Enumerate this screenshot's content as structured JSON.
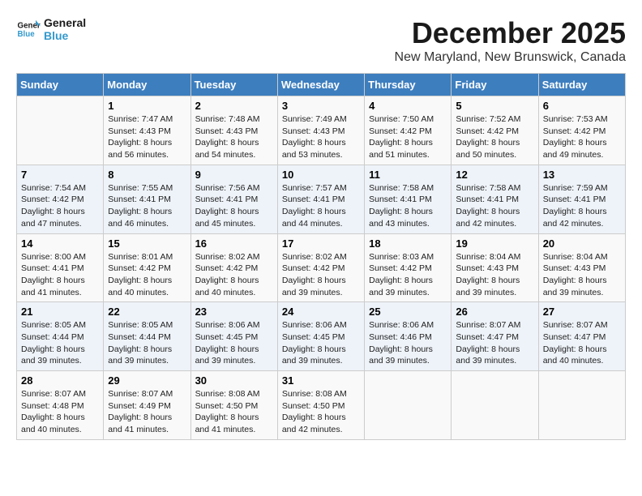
{
  "header": {
    "logo_line1": "General",
    "logo_line2": "Blue",
    "title": "December 2025",
    "subtitle": "New Maryland, New Brunswick, Canada"
  },
  "days_of_week": [
    "Sunday",
    "Monday",
    "Tuesday",
    "Wednesday",
    "Thursday",
    "Friday",
    "Saturday"
  ],
  "weeks": [
    [
      {
        "day": "",
        "info": ""
      },
      {
        "day": "1",
        "info": "Sunrise: 7:47 AM\nSunset: 4:43 PM\nDaylight: 8 hours\nand 56 minutes."
      },
      {
        "day": "2",
        "info": "Sunrise: 7:48 AM\nSunset: 4:43 PM\nDaylight: 8 hours\nand 54 minutes."
      },
      {
        "day": "3",
        "info": "Sunrise: 7:49 AM\nSunset: 4:43 PM\nDaylight: 8 hours\nand 53 minutes."
      },
      {
        "day": "4",
        "info": "Sunrise: 7:50 AM\nSunset: 4:42 PM\nDaylight: 8 hours\nand 51 minutes."
      },
      {
        "day": "5",
        "info": "Sunrise: 7:52 AM\nSunset: 4:42 PM\nDaylight: 8 hours\nand 50 minutes."
      },
      {
        "day": "6",
        "info": "Sunrise: 7:53 AM\nSunset: 4:42 PM\nDaylight: 8 hours\nand 49 minutes."
      }
    ],
    [
      {
        "day": "7",
        "info": "Sunrise: 7:54 AM\nSunset: 4:42 PM\nDaylight: 8 hours\nand 47 minutes."
      },
      {
        "day": "8",
        "info": "Sunrise: 7:55 AM\nSunset: 4:41 PM\nDaylight: 8 hours\nand 46 minutes."
      },
      {
        "day": "9",
        "info": "Sunrise: 7:56 AM\nSunset: 4:41 PM\nDaylight: 8 hours\nand 45 minutes."
      },
      {
        "day": "10",
        "info": "Sunrise: 7:57 AM\nSunset: 4:41 PM\nDaylight: 8 hours\nand 44 minutes."
      },
      {
        "day": "11",
        "info": "Sunrise: 7:58 AM\nSunset: 4:41 PM\nDaylight: 8 hours\nand 43 minutes."
      },
      {
        "day": "12",
        "info": "Sunrise: 7:58 AM\nSunset: 4:41 PM\nDaylight: 8 hours\nand 42 minutes."
      },
      {
        "day": "13",
        "info": "Sunrise: 7:59 AM\nSunset: 4:41 PM\nDaylight: 8 hours\nand 42 minutes."
      }
    ],
    [
      {
        "day": "14",
        "info": "Sunrise: 8:00 AM\nSunset: 4:41 PM\nDaylight: 8 hours\nand 41 minutes."
      },
      {
        "day": "15",
        "info": "Sunrise: 8:01 AM\nSunset: 4:42 PM\nDaylight: 8 hours\nand 40 minutes."
      },
      {
        "day": "16",
        "info": "Sunrise: 8:02 AM\nSunset: 4:42 PM\nDaylight: 8 hours\nand 40 minutes."
      },
      {
        "day": "17",
        "info": "Sunrise: 8:02 AM\nSunset: 4:42 PM\nDaylight: 8 hours\nand 39 minutes."
      },
      {
        "day": "18",
        "info": "Sunrise: 8:03 AM\nSunset: 4:42 PM\nDaylight: 8 hours\nand 39 minutes."
      },
      {
        "day": "19",
        "info": "Sunrise: 8:04 AM\nSunset: 4:43 PM\nDaylight: 8 hours\nand 39 minutes."
      },
      {
        "day": "20",
        "info": "Sunrise: 8:04 AM\nSunset: 4:43 PM\nDaylight: 8 hours\nand 39 minutes."
      }
    ],
    [
      {
        "day": "21",
        "info": "Sunrise: 8:05 AM\nSunset: 4:44 PM\nDaylight: 8 hours\nand 39 minutes."
      },
      {
        "day": "22",
        "info": "Sunrise: 8:05 AM\nSunset: 4:44 PM\nDaylight: 8 hours\nand 39 minutes."
      },
      {
        "day": "23",
        "info": "Sunrise: 8:06 AM\nSunset: 4:45 PM\nDaylight: 8 hours\nand 39 minutes."
      },
      {
        "day": "24",
        "info": "Sunrise: 8:06 AM\nSunset: 4:45 PM\nDaylight: 8 hours\nand 39 minutes."
      },
      {
        "day": "25",
        "info": "Sunrise: 8:06 AM\nSunset: 4:46 PM\nDaylight: 8 hours\nand 39 minutes."
      },
      {
        "day": "26",
        "info": "Sunrise: 8:07 AM\nSunset: 4:47 PM\nDaylight: 8 hours\nand 39 minutes."
      },
      {
        "day": "27",
        "info": "Sunrise: 8:07 AM\nSunset: 4:47 PM\nDaylight: 8 hours\nand 40 minutes."
      }
    ],
    [
      {
        "day": "28",
        "info": "Sunrise: 8:07 AM\nSunset: 4:48 PM\nDaylight: 8 hours\nand 40 minutes."
      },
      {
        "day": "29",
        "info": "Sunrise: 8:07 AM\nSunset: 4:49 PM\nDaylight: 8 hours\nand 41 minutes."
      },
      {
        "day": "30",
        "info": "Sunrise: 8:08 AM\nSunset: 4:50 PM\nDaylight: 8 hours\nand 41 minutes."
      },
      {
        "day": "31",
        "info": "Sunrise: 8:08 AM\nSunset: 4:50 PM\nDaylight: 8 hours\nand 42 minutes."
      },
      {
        "day": "",
        "info": ""
      },
      {
        "day": "",
        "info": ""
      },
      {
        "day": "",
        "info": ""
      }
    ]
  ]
}
